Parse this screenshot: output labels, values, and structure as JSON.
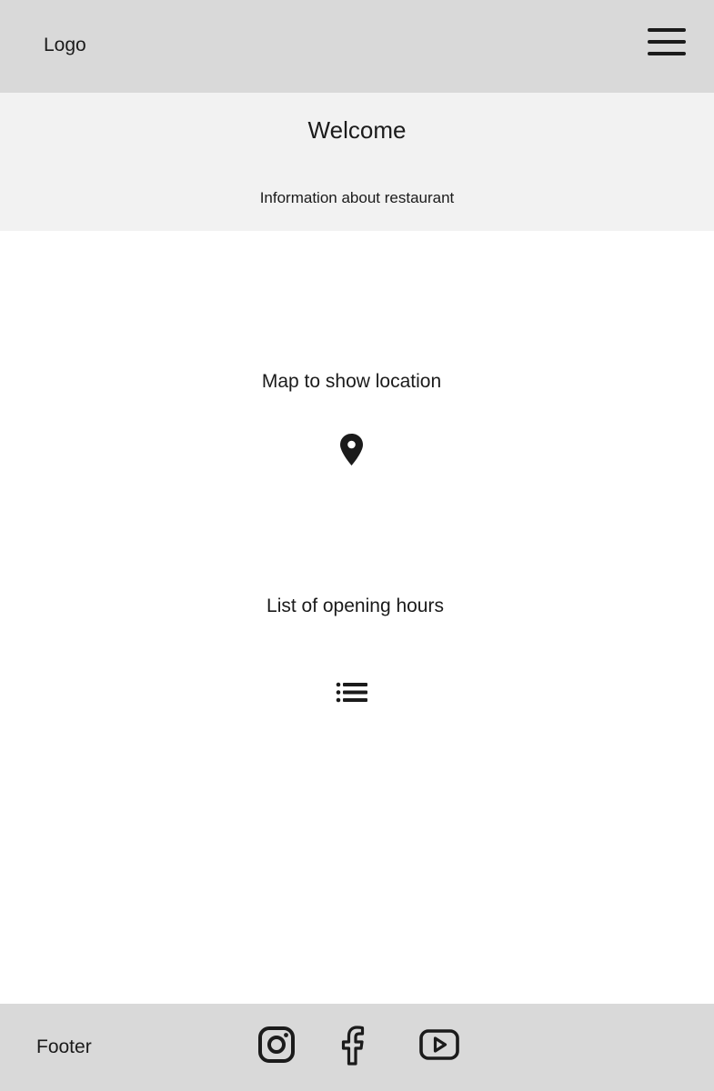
{
  "header": {
    "logo_text": "Logo",
    "menu_icon": "hamburger-menu-icon"
  },
  "welcome": {
    "title": "Welcome",
    "info": "Information about restaurant"
  },
  "main": {
    "map_label": "Map to show location",
    "map_icon": "map-pin-icon",
    "hours_label": "List of opening hours",
    "hours_icon": "list-icon"
  },
  "footer": {
    "label": "Footer",
    "social": [
      "instagram-icon",
      "facebook-icon",
      "youtube-icon"
    ]
  },
  "colors": {
    "header_bg": "#d9d9d9",
    "welcome_bg": "#f2f2f2",
    "page_bg": "#ffffff",
    "footer_bg": "#d9d9d9",
    "text": "#1b1b1b"
  }
}
